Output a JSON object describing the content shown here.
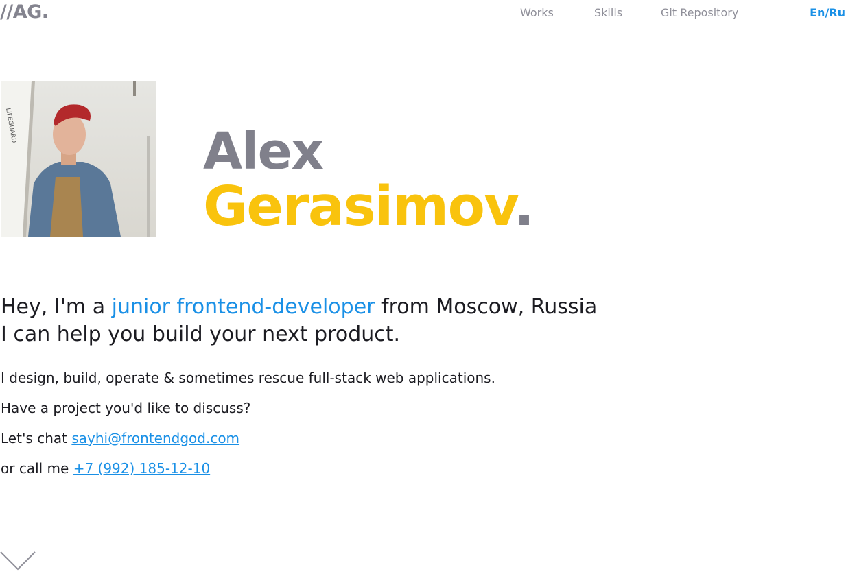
{
  "header": {
    "logo": "//AG.",
    "nav": [
      "Works",
      "Skills",
      "Git Repository"
    ],
    "lang_toggle": "En/Ru"
  },
  "hero": {
    "first_name": "Alex",
    "last_name": "Gerasimov",
    "last_dot": "."
  },
  "intro": {
    "prefix": "Hey, I'm a ",
    "role": "junior frontend-developer",
    "suffix": " from Moscow, Russia",
    "line2": "I can help you build your next product."
  },
  "about": {
    "line1": "I design, build, operate & sometimes rescue full-stack web applications.",
    "line2": "Have a project you'd like to discuss?",
    "chat_prefix": "Let's chat ",
    "email": "sayhi@frontendgod.com",
    "call_prefix": "or call me ",
    "phone": "+7 (992) 185-12-10"
  },
  "colors": {
    "accent_blue": "#1a90e6",
    "accent_yellow": "#f9c30d",
    "muted_gray": "#80808b"
  },
  "icons": {
    "scroll": "chevron-down-icon"
  }
}
